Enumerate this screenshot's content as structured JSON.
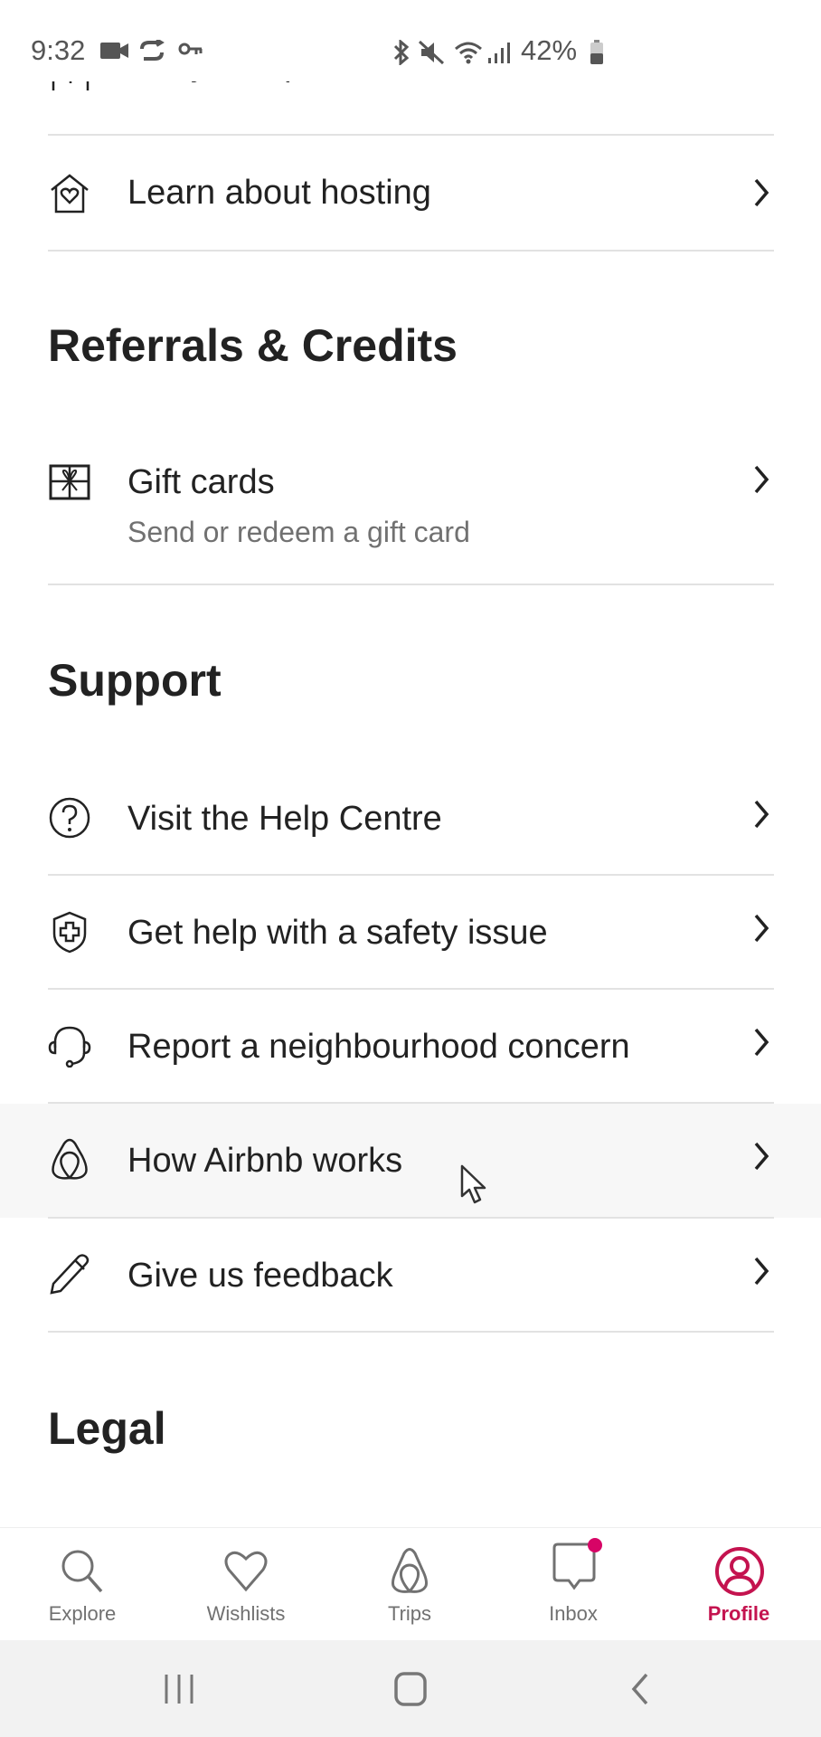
{
  "status_bar": {
    "time": "9:32",
    "battery": "42%",
    "left_icons": [
      "video-camera-icon",
      "sync-icon",
      "key-icon"
    ],
    "right_icons": [
      "bluetooth-icon",
      "mute-icon",
      "wifi-icon",
      "signal-icon",
      "battery-icon"
    ]
  },
  "partial_item": {
    "label": "List your space",
    "icon": "plus-square-icon"
  },
  "hosting": {
    "items": [
      {
        "label": "Learn about hosting",
        "icon": "house-heart-icon"
      }
    ]
  },
  "referrals": {
    "title": "Referrals & Credits",
    "items": [
      {
        "label": "Gift cards",
        "sublabel": "Send or redeem a gift card",
        "icon": "gift-card-icon"
      }
    ]
  },
  "support": {
    "title": "Support",
    "items": [
      {
        "label": "Visit the Help Centre",
        "icon": "question-circle-icon"
      },
      {
        "label": "Get help with a safety issue",
        "icon": "shield-cross-icon"
      },
      {
        "label": "Report a neighbourhood concern",
        "icon": "headset-icon"
      },
      {
        "label": "How Airbnb works",
        "icon": "airbnb-logo-icon"
      },
      {
        "label": "Give us feedback",
        "icon": "pencil-icon"
      }
    ]
  },
  "legal": {
    "title": "Legal"
  },
  "bottom_nav": {
    "active": "Profile",
    "accent_color": "#c4134f",
    "items": [
      {
        "label": "Explore",
        "icon": "search-icon"
      },
      {
        "label": "Wishlists",
        "icon": "heart-icon"
      },
      {
        "label": "Trips",
        "icon": "airbnb-logo-icon"
      },
      {
        "label": "Inbox",
        "icon": "message-icon",
        "badge": true
      },
      {
        "label": "Profile",
        "icon": "profile-icon"
      }
    ]
  },
  "system_nav": [
    "recents-button",
    "home-button",
    "back-button"
  ]
}
